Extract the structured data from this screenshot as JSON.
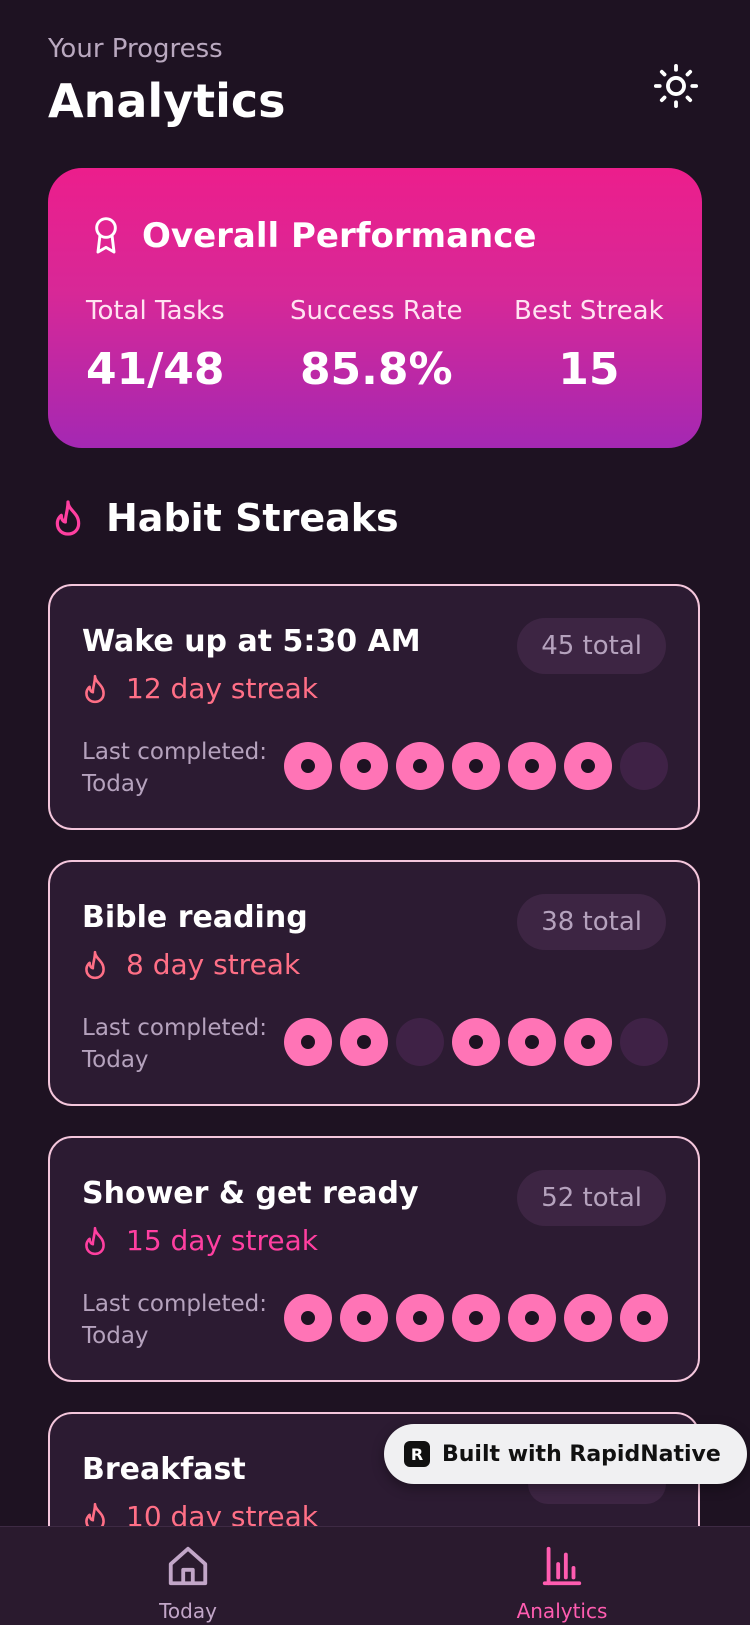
{
  "header": {
    "subtitle": "Your Progress",
    "title": "Analytics",
    "theme_icon": "sun-icon"
  },
  "overall": {
    "icon": "award-icon",
    "title": "Overall Performance",
    "stats": [
      {
        "label": "Total Tasks",
        "value": "41/48"
      },
      {
        "label": "Success Rate",
        "value": "85.8%"
      },
      {
        "label": "Best Streak",
        "value": "15"
      }
    ]
  },
  "streaks_section": {
    "icon": "flame-icon",
    "title": "Habit Streaks"
  },
  "habits": [
    {
      "name": "Wake up at 5:30 AM",
      "total": "45 total",
      "streak": "12 day streak",
      "streak_color": "#ff6f86",
      "last_label": "Last completed:",
      "last_value": "Today",
      "week": [
        1,
        1,
        1,
        1,
        1,
        1,
        0
      ]
    },
    {
      "name": "Bible reading",
      "total": "38 total",
      "streak": "8 day streak",
      "streak_color": "#ff6f86",
      "last_label": "Last completed:",
      "last_value": "Today",
      "week": [
        1,
        1,
        0,
        1,
        1,
        1,
        0
      ]
    },
    {
      "name": "Shower & get ready",
      "total": "52 total",
      "streak": "15 day streak",
      "streak_color": "#ff3fa0",
      "last_label": "Last completed:",
      "last_value": "Today",
      "week": [
        1,
        1,
        1,
        1,
        1,
        1,
        1
      ]
    },
    {
      "name": "Breakfast",
      "total": "",
      "streak": "10 day streak",
      "streak_color": "#ff6f86",
      "last_label": "",
      "last_value": "",
      "week": []
    }
  ],
  "badge": {
    "label": "Built with RapidNative",
    "logo": "R"
  },
  "tabs": [
    {
      "label": "Today",
      "icon": "home-icon",
      "active": false
    },
    {
      "label": "Analytics",
      "icon": "bar-chart-icon",
      "active": true
    }
  ],
  "colors": {
    "background": "#1e1222",
    "accent": "#ff5cb0",
    "card": "#2c1b32",
    "gradient_top": "#ec1e8c",
    "gradient_bottom": "#a428b3"
  }
}
